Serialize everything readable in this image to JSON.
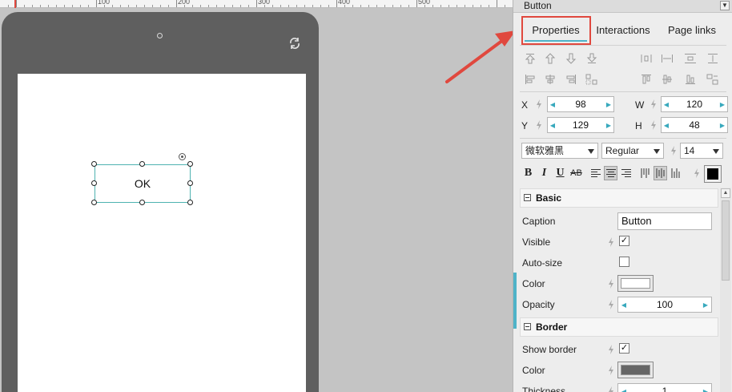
{
  "canvas": {
    "ruler_labels": [
      "100",
      "200",
      "300",
      "400",
      "500"
    ],
    "button_caption": "OK"
  },
  "panel": {
    "title": "Button",
    "collapse_icon": "chevron-double-down-icon",
    "tabs": {
      "properties": "Properties",
      "interactions": "Interactions",
      "page_links": "Page links"
    },
    "geometry": {
      "x_label": "X",
      "x_value": "98",
      "y_label": "Y",
      "y_value": "129",
      "w_label": "W",
      "w_value": "120",
      "h_label": "H",
      "h_value": "48"
    },
    "font": {
      "family": "微软雅黑",
      "style": "Regular",
      "size": "14"
    },
    "format_buttons": [
      "B",
      "I",
      "U",
      "AB"
    ],
    "text_color": "#000000"
  },
  "sections": {
    "basic": {
      "title": "Basic",
      "caption_label": "Caption",
      "caption_value": "Button",
      "visible_label": "Visible",
      "visible_checked": true,
      "autosize_label": "Auto-size",
      "autosize_checked": false,
      "color_label": "Color",
      "color_value": "#ffffff",
      "opacity_label": "Opacity",
      "opacity_value": "100"
    },
    "border": {
      "title": "Border",
      "show_border_label": "Show border",
      "show_border_checked": true,
      "color_label": "Color",
      "color_value": "#666666",
      "thickness_label": "Thickness",
      "thickness_value": "1"
    }
  },
  "colors": {
    "accent": "#4fb3c8",
    "highlight": "#e0483e",
    "selection": "#4fb3b1"
  }
}
